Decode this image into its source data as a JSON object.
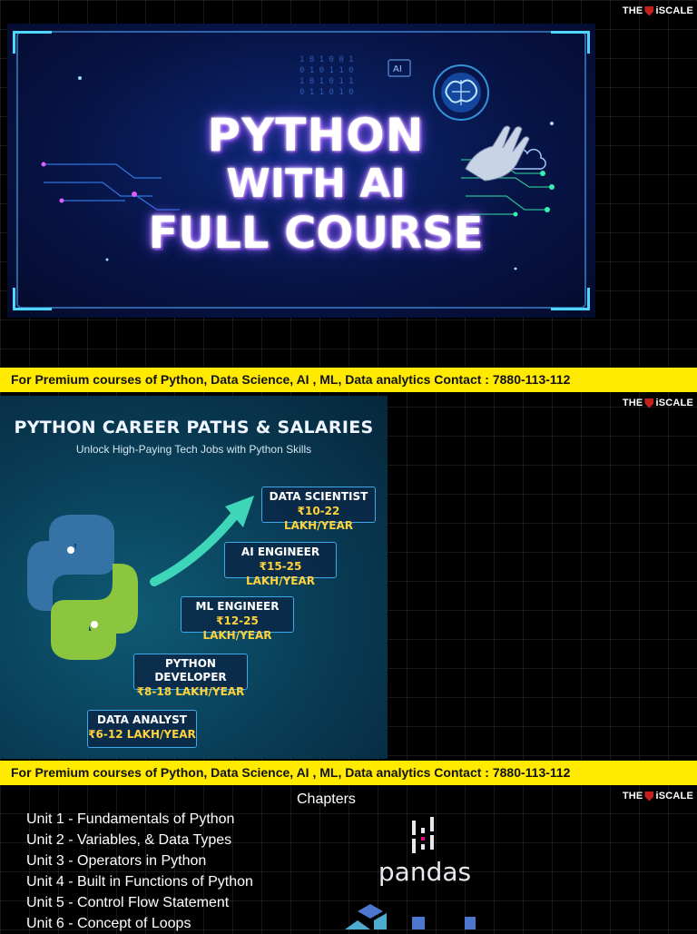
{
  "brand": {
    "name": "THE iSCALE"
  },
  "promo": {
    "text": "For Premium courses of Python, Data Science, AI , ML, Data analytics  Contact : 7880-113-112"
  },
  "hero": {
    "line1": "PYTHON",
    "line2": "WITH AI",
    "line3": "FULL COURSE",
    "ai_badge": "AI"
  },
  "career": {
    "title": "PYTHON CAREER PATHS & SALARIES",
    "subtitle": "Unlock High-Paying Tech Jobs with Python Skills",
    "jobs": [
      {
        "title": "DATA SCIENTIST",
        "salary": "₹10-22 LAKH/YEAR"
      },
      {
        "title": "AI ENGINEER",
        "salary": "₹15-25 LAKH/YEAR"
      },
      {
        "title": "ML ENGINEER",
        "salary": "₹12-25 LAKH/YEAR"
      },
      {
        "title": "PYTHON DEVELOPER",
        "salary": "₹8-18 LAKH/YEAR"
      },
      {
        "title": "DATA ANALYST",
        "salary": "₹6-12 LAKH/YEAR"
      }
    ]
  },
  "chapters": {
    "heading": "Chapters",
    "units": [
      "Unit 1 - Fundamentals of  Python",
      "Unit 2 - Variables, & Data Types",
      "Unit 3 - Operators in Python",
      "Unit 4 - Built in Functions of Python",
      "Unit 5 - Control Flow Statement",
      "Unit 6 - Concept of Loops"
    ],
    "pandas_label": "pandas"
  },
  "colors": {
    "promo_bg": "#ffea00",
    "hero_bg": "#071447",
    "career_bg": "#093e57",
    "salary": "#ffd23d",
    "python_blue": "#3572a5",
    "python_yellow": "#8cc63f"
  },
  "icons": [
    "shield-icon",
    "robot-hand-icon",
    "brain-icon",
    "cloud-icon",
    "python-logo-icon",
    "growth-arrow-icon",
    "pandas-logo-icon",
    "numpy-logo-icon"
  ]
}
